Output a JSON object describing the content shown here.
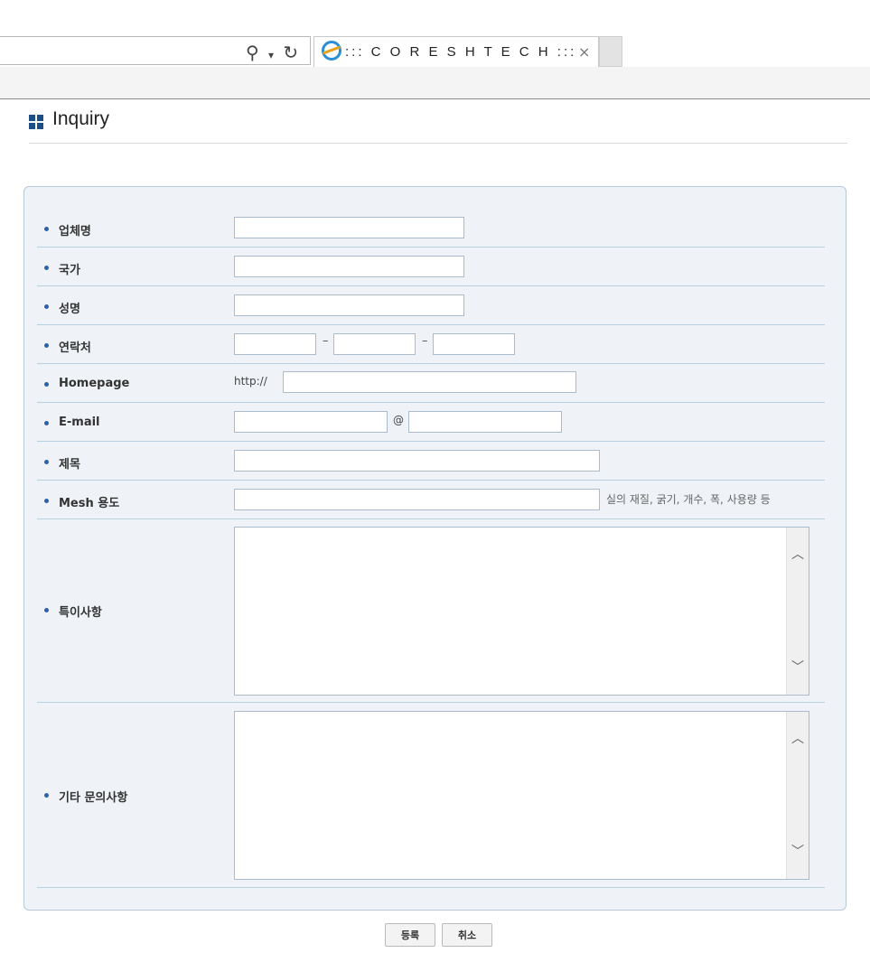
{
  "browser": {
    "tab_title": "::: C O R E S H T E C H :::",
    "tab_close": "×",
    "search_icon": "⚲",
    "dropdown_icon": "▾",
    "refresh_icon": "↻"
  },
  "page": {
    "title": "Inquiry"
  },
  "form": {
    "company_label": "업체명",
    "country_label": "국가",
    "name_label": "성명",
    "contact_label": "연락처",
    "contact_sep1": "–",
    "contact_sep2": "–",
    "homepage_label": "Homepage",
    "homepage_prefix": "http://",
    "email_label": "E-mail",
    "email_at": "@",
    "subject_label": "제목",
    "mesh_label": "Mesh 용도",
    "mesh_hint": "실의 재질, 굵기, 개수, 폭, 사용량 등",
    "notes_label": "특이사항",
    "other_label": "기타 문의사항"
  },
  "buttons": {
    "submit": "등록",
    "cancel": "취소"
  }
}
